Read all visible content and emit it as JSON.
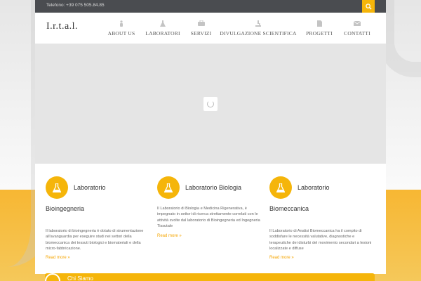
{
  "topbar": {
    "phone": "Telefono: +39 075 505.84.85",
    "search_icon": "search-icon"
  },
  "header": {
    "logo": "I.r.t.a.l."
  },
  "nav": [
    {
      "label": "ABOUT US",
      "icon": "person-icon"
    },
    {
      "label": "LABORATORI",
      "icon": "flask-icon"
    },
    {
      "label": "SERVIZI",
      "icon": "briefcase-icon"
    },
    {
      "label": "DIVULGAZIONE SCIENTIFICA",
      "icon": "microscope-icon"
    },
    {
      "label": "PROGETTI",
      "icon": "document-icon"
    },
    {
      "label": "CONTATTI",
      "icon": "envelope-icon"
    }
  ],
  "cards": [
    {
      "title_line1": "Laboratorio",
      "title_line2": "Bioingegneria",
      "desc": "Il laboratorio di bioingegneria è dotato di strumentazione all'avanguardia per eseguire studi nei settori della biomeccanica dei tessuti biologici e biomateriali e della micro-fabbricazione.",
      "more": "Read more »"
    },
    {
      "title_line1": "Laboratorio Biologia",
      "title_line2": "",
      "desc": "Il Laboratorio di Biologia e Medicina Rigenerativa, è impegnato in settori di ricerca strettamente correlati con le attività svolte dal laboratorio di Bioingegneria ed Ingegneria Tissutale",
      "more": "Read more »"
    },
    {
      "title_line1": "Laboratorio",
      "title_line2": "Biomeccanica",
      "desc": "Il Laboratorio di Analisi Biomeccanica ha il compito di soddisfare le necessità valutative, diagnostiche e terapeutiche dei disturbi del movimento secondari a lesioni localizzate e diffuse",
      "more": "Read more »"
    }
  ],
  "bottom": {
    "title": "Chi Siamo"
  },
  "colors": {
    "accent": "#f5b50a",
    "topbar": "#4a4c50"
  }
}
